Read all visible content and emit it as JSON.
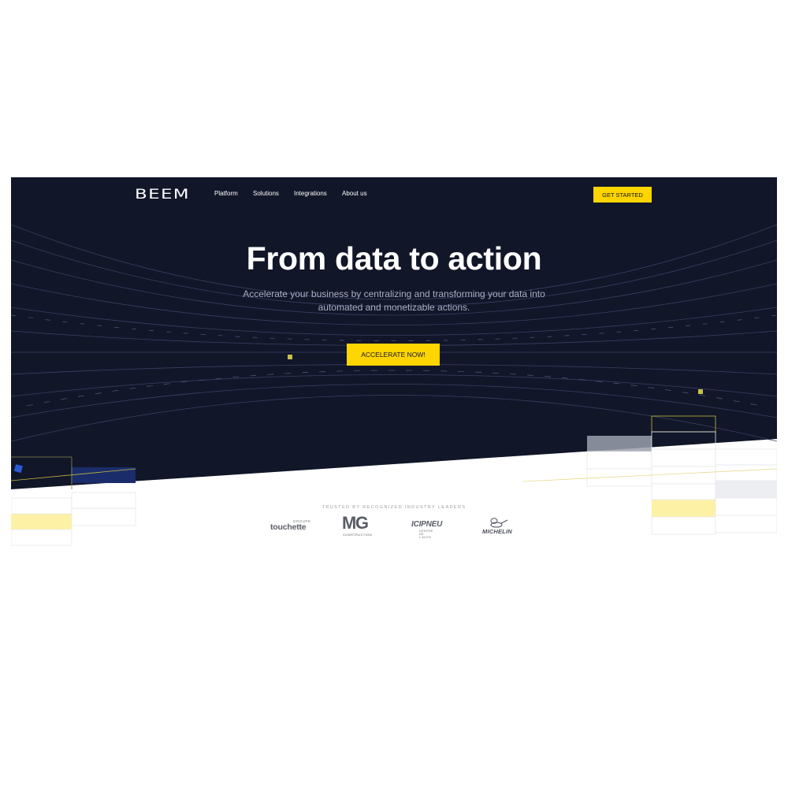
{
  "colors": {
    "hero_background": "#111629",
    "accent_yellow": "#ffd500",
    "accent_blue": "#2a5bd7",
    "subtitle_text": "#a9aec2"
  },
  "nav": {
    "logo": "BEEM",
    "links": [
      "Platform",
      "Solutions",
      "Integrations",
      "About us"
    ],
    "cta_label": "GET STARTED"
  },
  "hero": {
    "headline": "From data to action",
    "subtitle": "Accelerate your business by centralizing and transforming your data into automated and monetizable actions.",
    "cta_label": "ACCELERATE NOW!"
  },
  "trusted": {
    "heading": "TRUSTED BY RECOGNIZED INDUSTRY LEADERS",
    "logos": {
      "touchette": {
        "group": "GROUPE",
        "name": "touchette"
      },
      "mg": {
        "name": "MG",
        "sub": "CONSTRUCTION"
      },
      "icipneu": {
        "name": "ICIPNEU",
        "sub": "CENTRE DE L'AUTO"
      },
      "michelin": {
        "name": "MICHELIN"
      }
    }
  }
}
